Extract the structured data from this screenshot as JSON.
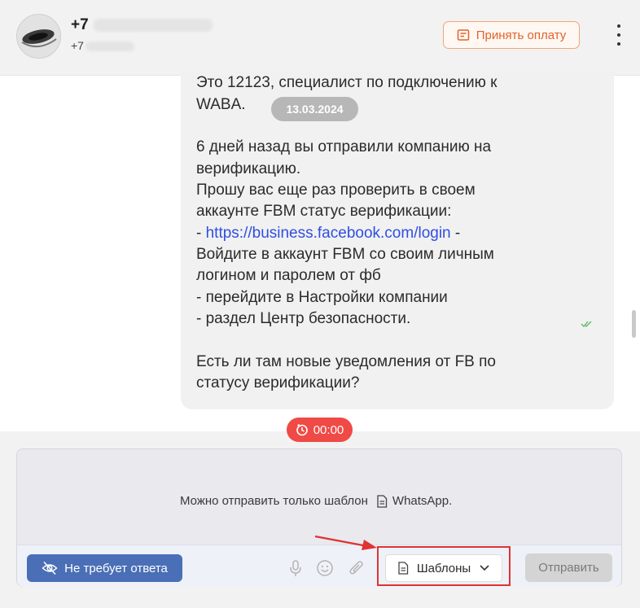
{
  "header": {
    "contact_phone": "+7",
    "contact_phone_sub": "+7",
    "pay_button_label": "Принять оплату"
  },
  "chat": {
    "date_badge": "13.03.2024",
    "message_lines": [
      "Это 12123, специалист по подключению к",
      "WABA.",
      "",
      "6 дней назад вы отправили компанию на",
      "верификацию.",
      "Прошу вас еще раз проверить в своем",
      "аккаунте FBM статус верификации:",
      "- ",
      "Войдите в аккаунт FBM со своим личным",
      "логином и паролем от фб",
      "- перейдите в Настройки компании",
      "- раздел Центр безопасности.",
      "",
      "Есть ли там новые уведомления от FB по",
      "статусу верификации?"
    ],
    "link_text": "https://business.facebook.com/login",
    "link_suffix": " -"
  },
  "timer": {
    "value": "00:00"
  },
  "composer": {
    "notice_prefix": "Можно отправить только шаблон",
    "notice_suffix": "WhatsApp.",
    "no_reply_label": "Не требует ответа",
    "templates_label": "Шаблоны",
    "send_label": "Отправить"
  },
  "colors": {
    "accent_orange": "#e0642a",
    "no_reply_blue": "#4a6fb6",
    "timer_red": "#ef4a45",
    "link_blue": "#2f4fe0",
    "highlight_red": "#e03333"
  },
  "icons": {
    "pay": "receipt-icon",
    "menu": "kebab-menu-icon",
    "timer": "timer-icon",
    "template_doc": "document-icon",
    "no_reply": "eye-off-icon",
    "mic": "microphone-icon",
    "emoji": "emoji-icon",
    "attach": "paperclip-icon",
    "dropdown": "chevron-down-icon",
    "read_status": "double-check-icon"
  }
}
